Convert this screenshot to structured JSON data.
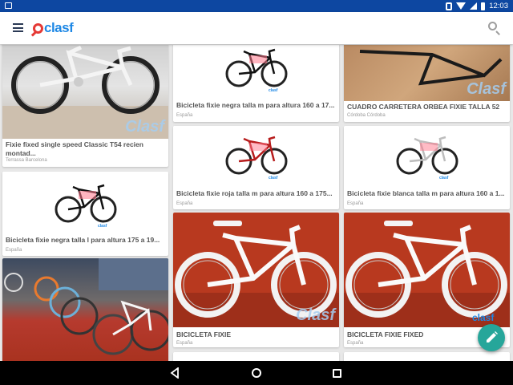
{
  "status_bar": {
    "time": "12:03"
  },
  "app_bar": {
    "logo_text": "clasf"
  },
  "colors": {
    "primary_dark": "#0d47a1",
    "brand_blue": "#1e88e5",
    "brand_red": "#e53935",
    "fab": "#26a69a"
  },
  "watermark": "Clasf",
  "listings": [
    {
      "title": "Fixie fixed single speed Classic T54 recien montad...",
      "location": "Terrassa Barcelona"
    },
    {
      "title": "Bicicleta fixie negra talla l para altura 175 a 19...",
      "location": "España"
    },
    {
      "title": "Bicicleta fixie negra talla m para altura 160 a 17...",
      "location": "España"
    },
    {
      "title": "Bicicleta fixie roja talla m para altura 160 a 175...",
      "location": "España"
    },
    {
      "title": "BICICLETA FIXIE",
      "location": "España"
    },
    {
      "title": "CUADRO CARRETERA ORBEA FIXIE TALLA 52",
      "location": "Córdoba Córdoba"
    },
    {
      "title": "Bicicleta fixie blanca talla m para altura 160 a 1...",
      "location": "España"
    },
    {
      "title": "BICICLETA FIXIE FIXED",
      "location": "España"
    }
  ],
  "icons": {
    "menu": "hamburger-icon",
    "search": "search-icon",
    "fab": "pencil-icon",
    "nav_back": "back-triangle-icon",
    "nav_home": "home-circle-icon",
    "nav_recent": "recents-square-icon"
  }
}
